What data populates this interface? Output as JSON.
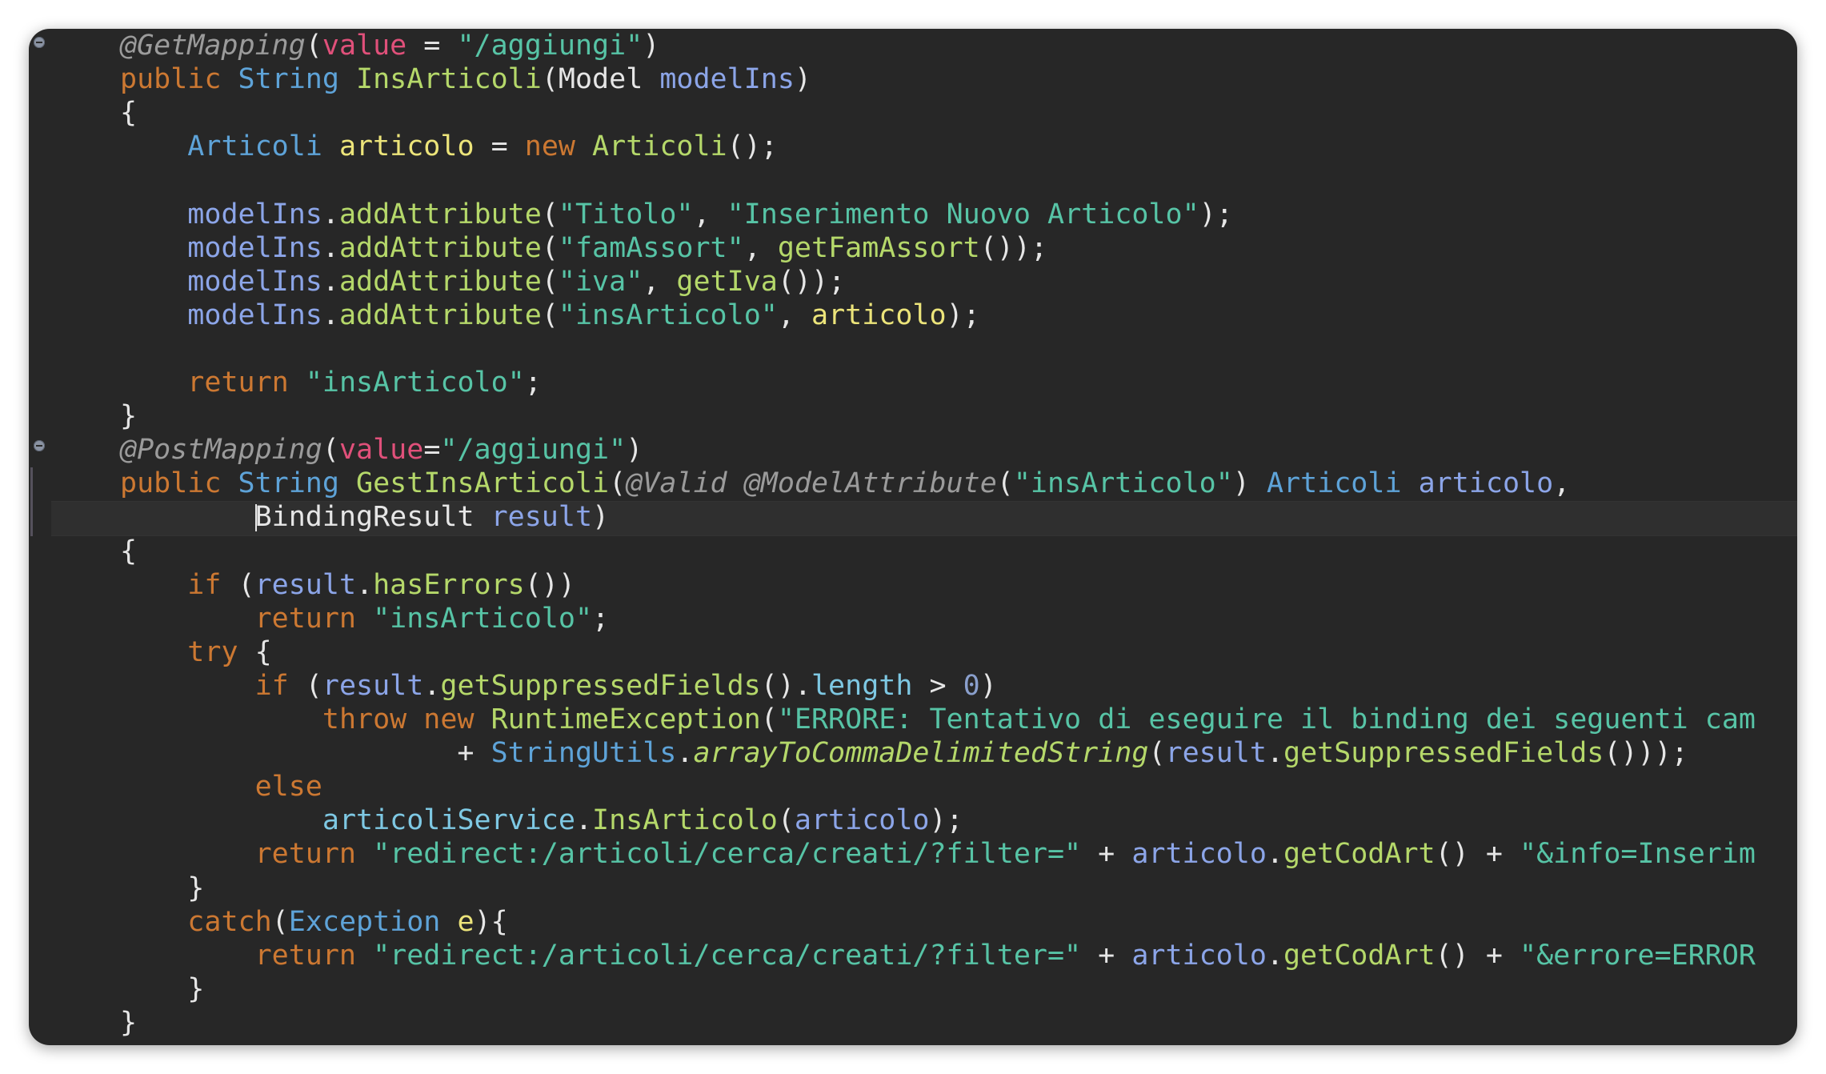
{
  "editor": {
    "lines": [
      [
        [
          "ann",
          "@GetMapping"
        ],
        [
          "punct",
          "("
        ],
        [
          "attr",
          "value"
        ],
        [
          "punct",
          " = "
        ],
        [
          "string",
          "\"/aggiungi\""
        ],
        [
          "punct",
          ")"
        ]
      ],
      [
        [
          "key",
          "public "
        ],
        [
          "type",
          "String "
        ],
        [
          "method",
          "InsArticoli"
        ],
        [
          "punct",
          "("
        ],
        [
          "plain",
          "Model "
        ],
        [
          "var",
          "modelIns"
        ],
        [
          "punct",
          ")"
        ]
      ],
      [
        [
          "punct",
          "{"
        ]
      ],
      [
        [
          "plain",
          "    "
        ],
        [
          "type",
          "Articoli "
        ],
        [
          "local",
          "articolo"
        ],
        [
          "punct",
          " = "
        ],
        [
          "key",
          "new "
        ],
        [
          "method",
          "Articoli"
        ],
        [
          "punct",
          "();"
        ]
      ],
      [],
      [
        [
          "plain",
          "    "
        ],
        [
          "var",
          "modelIns"
        ],
        [
          "punct",
          "."
        ],
        [
          "method",
          "addAttribute"
        ],
        [
          "punct",
          "("
        ],
        [
          "string",
          "\"Titolo\""
        ],
        [
          "punct",
          ", "
        ],
        [
          "string",
          "\"Inserimento Nuovo Articolo\""
        ],
        [
          "punct",
          ");"
        ]
      ],
      [
        [
          "plain",
          "    "
        ],
        [
          "var",
          "modelIns"
        ],
        [
          "punct",
          "."
        ],
        [
          "method",
          "addAttribute"
        ],
        [
          "punct",
          "("
        ],
        [
          "string",
          "\"famAssort\""
        ],
        [
          "punct",
          ", "
        ],
        [
          "method",
          "getFamAssort"
        ],
        [
          "punct",
          "());"
        ]
      ],
      [
        [
          "plain",
          "    "
        ],
        [
          "var",
          "modelIns"
        ],
        [
          "punct",
          "."
        ],
        [
          "method",
          "addAttribute"
        ],
        [
          "punct",
          "("
        ],
        [
          "string",
          "\"iva\""
        ],
        [
          "punct",
          ", "
        ],
        [
          "method",
          "getIva"
        ],
        [
          "punct",
          "());"
        ]
      ],
      [
        [
          "plain",
          "    "
        ],
        [
          "var",
          "modelIns"
        ],
        [
          "punct",
          "."
        ],
        [
          "method",
          "addAttribute"
        ],
        [
          "punct",
          "("
        ],
        [
          "string",
          "\"insArticolo\""
        ],
        [
          "punct",
          ", "
        ],
        [
          "local",
          "articolo"
        ],
        [
          "punct",
          ");"
        ]
      ],
      [],
      [
        [
          "plain",
          "    "
        ],
        [
          "key",
          "return "
        ],
        [
          "string",
          "\"insArticolo\""
        ],
        [
          "punct",
          ";"
        ]
      ],
      [
        [
          "punct",
          "}"
        ]
      ],
      [
        [
          "ann",
          "@PostMapping"
        ],
        [
          "punct",
          "("
        ],
        [
          "attr",
          "value"
        ],
        [
          "punct",
          "="
        ],
        [
          "string",
          "\"/aggiungi\""
        ],
        [
          "punct",
          ")"
        ]
      ],
      [
        [
          "key",
          "public "
        ],
        [
          "type",
          "String "
        ],
        [
          "method",
          "GestInsArticoli"
        ],
        [
          "punct",
          "("
        ],
        [
          "ann",
          "@Valid @ModelAttribute"
        ],
        [
          "punct",
          "("
        ],
        [
          "string",
          "\"insArticolo\""
        ],
        [
          "punct",
          ") "
        ],
        [
          "type",
          "Articoli "
        ],
        [
          "var",
          "articolo"
        ],
        [
          "punct",
          ","
        ]
      ],
      [
        [
          "plain",
          "        "
        ],
        [
          "caret",
          ""
        ],
        [
          "plain",
          "BindingResult "
        ],
        [
          "var",
          "result"
        ],
        [
          "punct",
          ")"
        ]
      ],
      [
        [
          "punct",
          "{"
        ]
      ],
      [
        [
          "plain",
          "    "
        ],
        [
          "key",
          "if "
        ],
        [
          "punct",
          "("
        ],
        [
          "var",
          "result"
        ],
        [
          "punct",
          "."
        ],
        [
          "method",
          "hasErrors"
        ],
        [
          "punct",
          "())"
        ]
      ],
      [
        [
          "plain",
          "        "
        ],
        [
          "key",
          "return "
        ],
        [
          "string",
          "\"insArticolo\""
        ],
        [
          "punct",
          ";"
        ]
      ],
      [
        [
          "plain",
          "    "
        ],
        [
          "key",
          "try "
        ],
        [
          "punct",
          "{"
        ]
      ],
      [
        [
          "plain",
          "        "
        ],
        [
          "key",
          "if "
        ],
        [
          "punct",
          "("
        ],
        [
          "var",
          "result"
        ],
        [
          "punct",
          "."
        ],
        [
          "method",
          "getSuppressedFields"
        ],
        [
          "punct",
          "()."
        ],
        [
          "field",
          "length"
        ],
        [
          "punct",
          " > "
        ],
        [
          "num",
          "0"
        ],
        [
          "punct",
          ")"
        ]
      ],
      [
        [
          "plain",
          "            "
        ],
        [
          "key",
          "throw new "
        ],
        [
          "method",
          "RuntimeException"
        ],
        [
          "punct",
          "("
        ],
        [
          "string",
          "\"ERRORE: Tentativo di eseguire il binding dei seguenti cam"
        ]
      ],
      [
        [
          "plain",
          "                    + "
        ],
        [
          "type",
          "StringUtils"
        ],
        [
          "punct",
          "."
        ],
        [
          "static",
          "arrayToCommaDelimitedString"
        ],
        [
          "punct",
          "("
        ],
        [
          "var",
          "result"
        ],
        [
          "punct",
          "."
        ],
        [
          "method",
          "getSuppressedFields"
        ],
        [
          "punct",
          "()));"
        ]
      ],
      [
        [
          "plain",
          "        "
        ],
        [
          "key",
          "else"
        ]
      ],
      [
        [
          "plain",
          "            "
        ],
        [
          "field",
          "articoliService"
        ],
        [
          "punct",
          "."
        ],
        [
          "method",
          "InsArticolo"
        ],
        [
          "punct",
          "("
        ],
        [
          "var",
          "articolo"
        ],
        [
          "punct",
          ");"
        ]
      ],
      [
        [
          "plain",
          "        "
        ],
        [
          "key",
          "return "
        ],
        [
          "string",
          "\"redirect:/articoli/cerca/creati/?filter=\""
        ],
        [
          "punct",
          " + "
        ],
        [
          "var",
          "articolo"
        ],
        [
          "punct",
          "."
        ],
        [
          "method",
          "getCodArt"
        ],
        [
          "punct",
          "() + "
        ],
        [
          "string",
          "\"&info=Inserim"
        ]
      ],
      [
        [
          "plain",
          "    "
        ],
        [
          "punct",
          "}"
        ]
      ],
      [
        [
          "plain",
          "    "
        ],
        [
          "key",
          "catch"
        ],
        [
          "punct",
          "("
        ],
        [
          "type",
          "Exception "
        ],
        [
          "local",
          "e"
        ],
        [
          "punct",
          "){"
        ]
      ],
      [
        [
          "plain",
          "        "
        ],
        [
          "key",
          "return "
        ],
        [
          "string",
          "\"redirect:/articoli/cerca/creati/?filter=\""
        ],
        [
          "punct",
          " + "
        ],
        [
          "var",
          "articolo"
        ],
        [
          "punct",
          "."
        ],
        [
          "method",
          "getCodArt"
        ],
        [
          "punct",
          "() + "
        ],
        [
          "string",
          "\"&errore=ERROR"
        ]
      ],
      [
        [
          "plain",
          "    "
        ],
        [
          "punct",
          "}"
        ]
      ],
      [
        [
          "punct",
          "}"
        ]
      ]
    ]
  },
  "colors": {
    "background": "#272727",
    "keyword": "#cc7832",
    "type": "#5ea3d8",
    "string": "#57c4a6",
    "method": "#b5d86a",
    "annotation": "#9b9b9b",
    "attribute": "#e0507a"
  },
  "icons": {
    "fold_marker": "minus-circle-icon"
  }
}
